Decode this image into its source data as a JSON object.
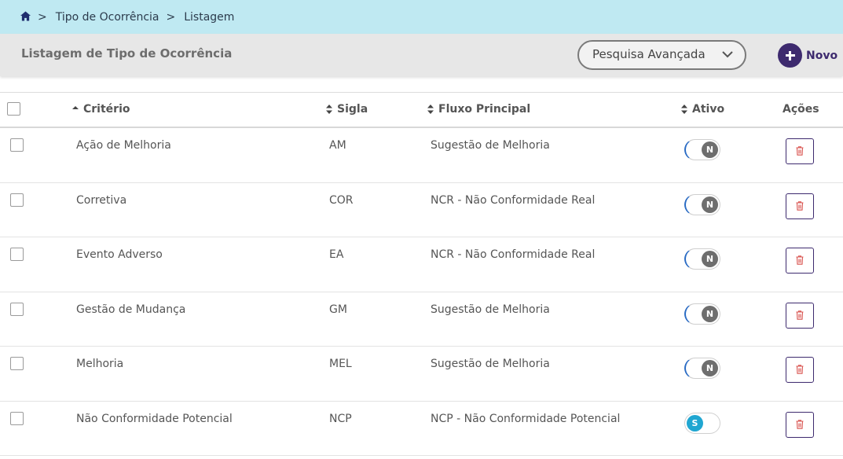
{
  "breadcrumb": {
    "items": [
      "Tipo de Ocorrência",
      "Listagem"
    ],
    "separator": ">"
  },
  "header": {
    "title": "Listagem de Tipo de Ocorrência",
    "search_advanced_label": "Pesquisa Avançada",
    "new_button_label": "Novo"
  },
  "table": {
    "columns": {
      "criterio": "Critério",
      "sigla": "Sigla",
      "fluxo": "Fluxo Principal",
      "ativo": "Ativo",
      "acoes": "Ações"
    },
    "rows": [
      {
        "criterio": "Ação de Melhoria",
        "sigla": "AM",
        "fluxo": "Sugestão de Melhoria",
        "ativo": "N"
      },
      {
        "criterio": "Corretiva",
        "sigla": "COR",
        "fluxo": "NCR - Não Conformidade Real",
        "ativo": "N"
      },
      {
        "criterio": "Evento Adverso",
        "sigla": "EA",
        "fluxo": "NCR - Não Conformidade Real",
        "ativo": "N"
      },
      {
        "criterio": "Gestão de Mudança",
        "sigla": "GM",
        "fluxo": "Sugestão de Melhoria",
        "ativo": "N"
      },
      {
        "criterio": "Melhoria",
        "sigla": "MEL",
        "fluxo": "Sugestão de Melhoria",
        "ativo": "N"
      },
      {
        "criterio": "Não Conformidade Potencial",
        "sigla": "NCP",
        "fluxo": "NCP - Não Conformidade Potencial",
        "ativo": "S"
      }
    ]
  },
  "colors": {
    "breadcrumb_bg": "#bfe9f2",
    "header_bg": "#e7e7e7",
    "accent": "#3d2a6e",
    "toggle_on": "#20a6d1",
    "toggle_off": "#6e6e6e",
    "delete_icon": "#d9534f"
  },
  "icons": {
    "home": "home-icon",
    "chevron": "chevron-down-icon",
    "add": "plus-icon",
    "sort": "sort-icon",
    "delete": "trash-icon"
  }
}
